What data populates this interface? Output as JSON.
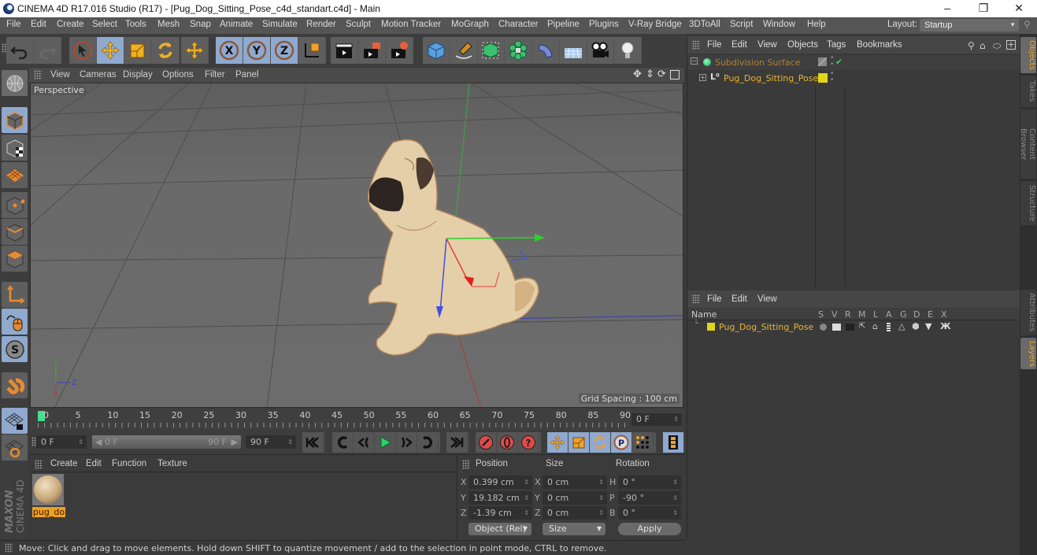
{
  "window": {
    "title": "CINEMA 4D R17.016 Studio (R17) - [Pug_Dog_Sitting_Pose_c4d_standart.c4d] - Main",
    "controls": [
      "minimize",
      "restore",
      "close"
    ]
  },
  "menubar": {
    "items": [
      "File",
      "Edit",
      "Create",
      "Select",
      "Tools",
      "Mesh",
      "Snap",
      "Animate",
      "Simulate",
      "Render",
      "Sculpt",
      "Motion Tracker",
      "MoGraph",
      "Character",
      "Pipeline",
      "Plugins",
      "V-Ray Bridge",
      "3DToAll",
      "Script",
      "Window",
      "Help"
    ],
    "layout_label": "Layout:",
    "layout_value": "Startup"
  },
  "toolbar": {
    "groups": [
      {
        "name": "history",
        "tools": [
          {
            "id": "undo",
            "icon": "undo-icon"
          },
          {
            "id": "redo",
            "icon": "redo-icon"
          }
        ]
      },
      {
        "name": "mode",
        "tools": [
          {
            "id": "live-selection",
            "icon": "cursor-icon"
          },
          {
            "id": "move",
            "icon": "move-icon",
            "active": true
          },
          {
            "id": "scale",
            "icon": "scale-icon"
          },
          {
            "id": "rotate",
            "icon": "rotate-icon"
          }
        ]
      },
      {
        "name": "last-tool",
        "tools": [
          {
            "id": "recent-move",
            "icon": "move-icon"
          }
        ]
      },
      {
        "name": "axis",
        "tools": [
          {
            "id": "x-axis",
            "icon": "x-axis-icon",
            "active": true
          },
          {
            "id": "y-axis",
            "icon": "y-axis-icon",
            "active": true
          },
          {
            "id": "z-axis",
            "icon": "z-axis-icon",
            "active": true
          },
          {
            "id": "coordinate-system",
            "icon": "world-coords-icon"
          }
        ]
      },
      {
        "name": "render",
        "tools": [
          {
            "id": "render-view",
            "icon": "clapper-icon"
          },
          {
            "id": "render-picture-viewer",
            "icon": "clapper-window-icon"
          },
          {
            "id": "render-settings",
            "icon": "clapper-gear-icon"
          }
        ]
      },
      {
        "name": "objects",
        "tools": [
          {
            "id": "cube",
            "icon": "cube-icon"
          },
          {
            "id": "pen",
            "icon": "pen-icon"
          },
          {
            "id": "subdivision",
            "icon": "subdivision-icon"
          },
          {
            "id": "cloner",
            "icon": "cloner-icon"
          },
          {
            "id": "deformer",
            "icon": "bend-icon"
          },
          {
            "id": "floor",
            "icon": "floor-icon"
          },
          {
            "id": "camera",
            "icon": "camera-icon"
          },
          {
            "id": "light",
            "icon": "light-bulb-icon"
          }
        ]
      }
    ]
  },
  "leftbar": {
    "tools": [
      {
        "id": "make-editable",
        "icon": "sphere-grid-icon"
      },
      {
        "id": "model-mode",
        "icon": "cube-model-icon",
        "active": true
      },
      {
        "id": "texture-mode",
        "icon": "checker-cube-icon"
      },
      {
        "id": "workplane-mode",
        "icon": "workplane-icon"
      },
      {
        "id": "points-mode",
        "icon": "points-icon"
      },
      {
        "id": "edges-mode",
        "icon": "edges-icon"
      },
      {
        "id": "polygons-mode",
        "icon": "polygons-icon"
      },
      {
        "id": "enable-axis",
        "icon": "axis-icon"
      },
      {
        "id": "tweak-mode",
        "icon": "mouse-icon",
        "active": true
      },
      {
        "id": "solo",
        "icon": "solo-icon",
        "active": true
      },
      {
        "id": "snap",
        "icon": "magnet-icon"
      },
      {
        "id": "lock-workplane",
        "icon": "grid-lock-icon",
        "active": true
      },
      {
        "id": "planar-workplane",
        "icon": "grid-rotate-icon"
      }
    ]
  },
  "viewport": {
    "menu": [
      "View",
      "Cameras",
      "Display",
      "Options",
      "Filter",
      "Panel"
    ],
    "camera_label": "Perspective",
    "grid_spacing": "Grid Spacing : 100 cm",
    "nav_icons": [
      "pan-icon",
      "dolly-icon",
      "orbit-icon",
      "maximize-icon"
    ],
    "axis_labels": {
      "y": "Y",
      "z": "Z",
      "x": "X"
    }
  },
  "timeline": {
    "ticks": [
      "0",
      "5",
      "10",
      "15",
      "20",
      "25",
      "30",
      "35",
      "40",
      "45",
      "50",
      "55",
      "60",
      "65",
      "70",
      "75",
      "80",
      "85",
      "90"
    ],
    "current_frame_field": "0 F",
    "playhead_frame": 0
  },
  "transport": {
    "start_field": "0 F",
    "range_start": "0 F",
    "range_end": "90 F",
    "end_field": "90 F",
    "buttons": [
      {
        "id": "go-to-start",
        "icon": "go-start-icon"
      },
      {
        "id": "prev-key",
        "icon": "prev-key-icon"
      },
      {
        "id": "prev-frame",
        "icon": "prev-frame-icon"
      },
      {
        "id": "play",
        "icon": "play-icon"
      },
      {
        "id": "next-frame",
        "icon": "next-frame-icon"
      },
      {
        "id": "next-key",
        "icon": "next-key-icon"
      },
      {
        "id": "go-to-end",
        "icon": "go-end-icon"
      },
      {
        "id": "record",
        "icon": "record-key-icon"
      },
      {
        "id": "autokey",
        "icon": "autokey-icon"
      },
      {
        "id": "keyframe-selection",
        "icon": "help-key-icon"
      },
      {
        "id": "key-position",
        "icon": "move-icon",
        "active": true
      },
      {
        "id": "key-scale",
        "icon": "scale-icon",
        "active": true
      },
      {
        "id": "key-rotation",
        "icon": "rotate-icon",
        "active": true
      },
      {
        "id": "key-parameter",
        "icon": "parameter-icon",
        "active": true
      },
      {
        "id": "key-pla",
        "icon": "pla-dots-icon"
      },
      {
        "id": "timeline-window",
        "icon": "film-strip-icon",
        "active": true
      }
    ]
  },
  "material_manager": {
    "menu": [
      "Create",
      "Edit",
      "Function",
      "Texture"
    ],
    "materials": [
      {
        "name": "pug_do",
        "selected": true
      }
    ]
  },
  "coordinates": {
    "headers": [
      "Position",
      "Size",
      "Rotation"
    ],
    "rows": [
      {
        "pos_axis": "X",
        "pos": "0.399 cm",
        "size_axis": "X",
        "size": "0 cm",
        "rot_axis": "H",
        "rot": "0 °"
      },
      {
        "pos_axis": "Y",
        "pos": "19.182 cm",
        "size_axis": "Y",
        "size": "0 cm",
        "rot_axis": "P",
        "rot": "-90 °"
      },
      {
        "pos_axis": "Z",
        "pos": "-1.39 cm",
        "size_axis": "Z",
        "size": "0 cm",
        "rot_axis": "B",
        "rot": "0 °"
      }
    ],
    "mode_select": "Object (Rel)",
    "size_select": "Size",
    "apply_label": "Apply"
  },
  "status": {
    "text": "Move: Click and drag to move elements. Hold down SHIFT to quantize movement / add to the selection in point mode, CTRL to remove."
  },
  "object_manager": {
    "menu": [
      "File",
      "Edit",
      "View",
      "Objects",
      "Tags",
      "Bookmarks"
    ],
    "header_icons": [
      "search-icon",
      "home-icon",
      "link-icon",
      "new-view-icon"
    ],
    "objects": [
      {
        "name": "Subdivision Surface",
        "icon": "subdivision-icon",
        "color": "#b0802a",
        "enabled": true,
        "depth": 0
      },
      {
        "name": "Pug_Dog_Sitting_Pose",
        "icon": "null-icon",
        "color": "#e8b62c",
        "layer_color": "#e2d51c",
        "depth": 1
      }
    ]
  },
  "layer_manager": {
    "menu": [
      "File",
      "Edit",
      "View"
    ],
    "columns": [
      "Name",
      "S",
      "V",
      "R",
      "M",
      "L",
      "A",
      "G",
      "D",
      "E",
      "X"
    ],
    "layers": [
      {
        "name": "Pug_Dog_Sitting_Pose",
        "color": "#e2d51c"
      }
    ]
  },
  "side_tabs": {
    "top": [
      {
        "label": "Objects",
        "active": true
      },
      {
        "label": "Takes"
      },
      {
        "label": "Content Browser"
      },
      {
        "label": "Structure"
      }
    ],
    "bottom": [
      {
        "label": "Attributes"
      },
      {
        "label": "Layers",
        "active": true
      }
    ]
  },
  "branding": {
    "maker": "MAXON",
    "product": "CINEMA 4D"
  },
  "colors": {
    "accent_blue": "#8fa9cf",
    "highlight_orange": "#e9a93a",
    "object_yellow": "#e8b62c",
    "panel_bg": "#3a3a3a"
  }
}
